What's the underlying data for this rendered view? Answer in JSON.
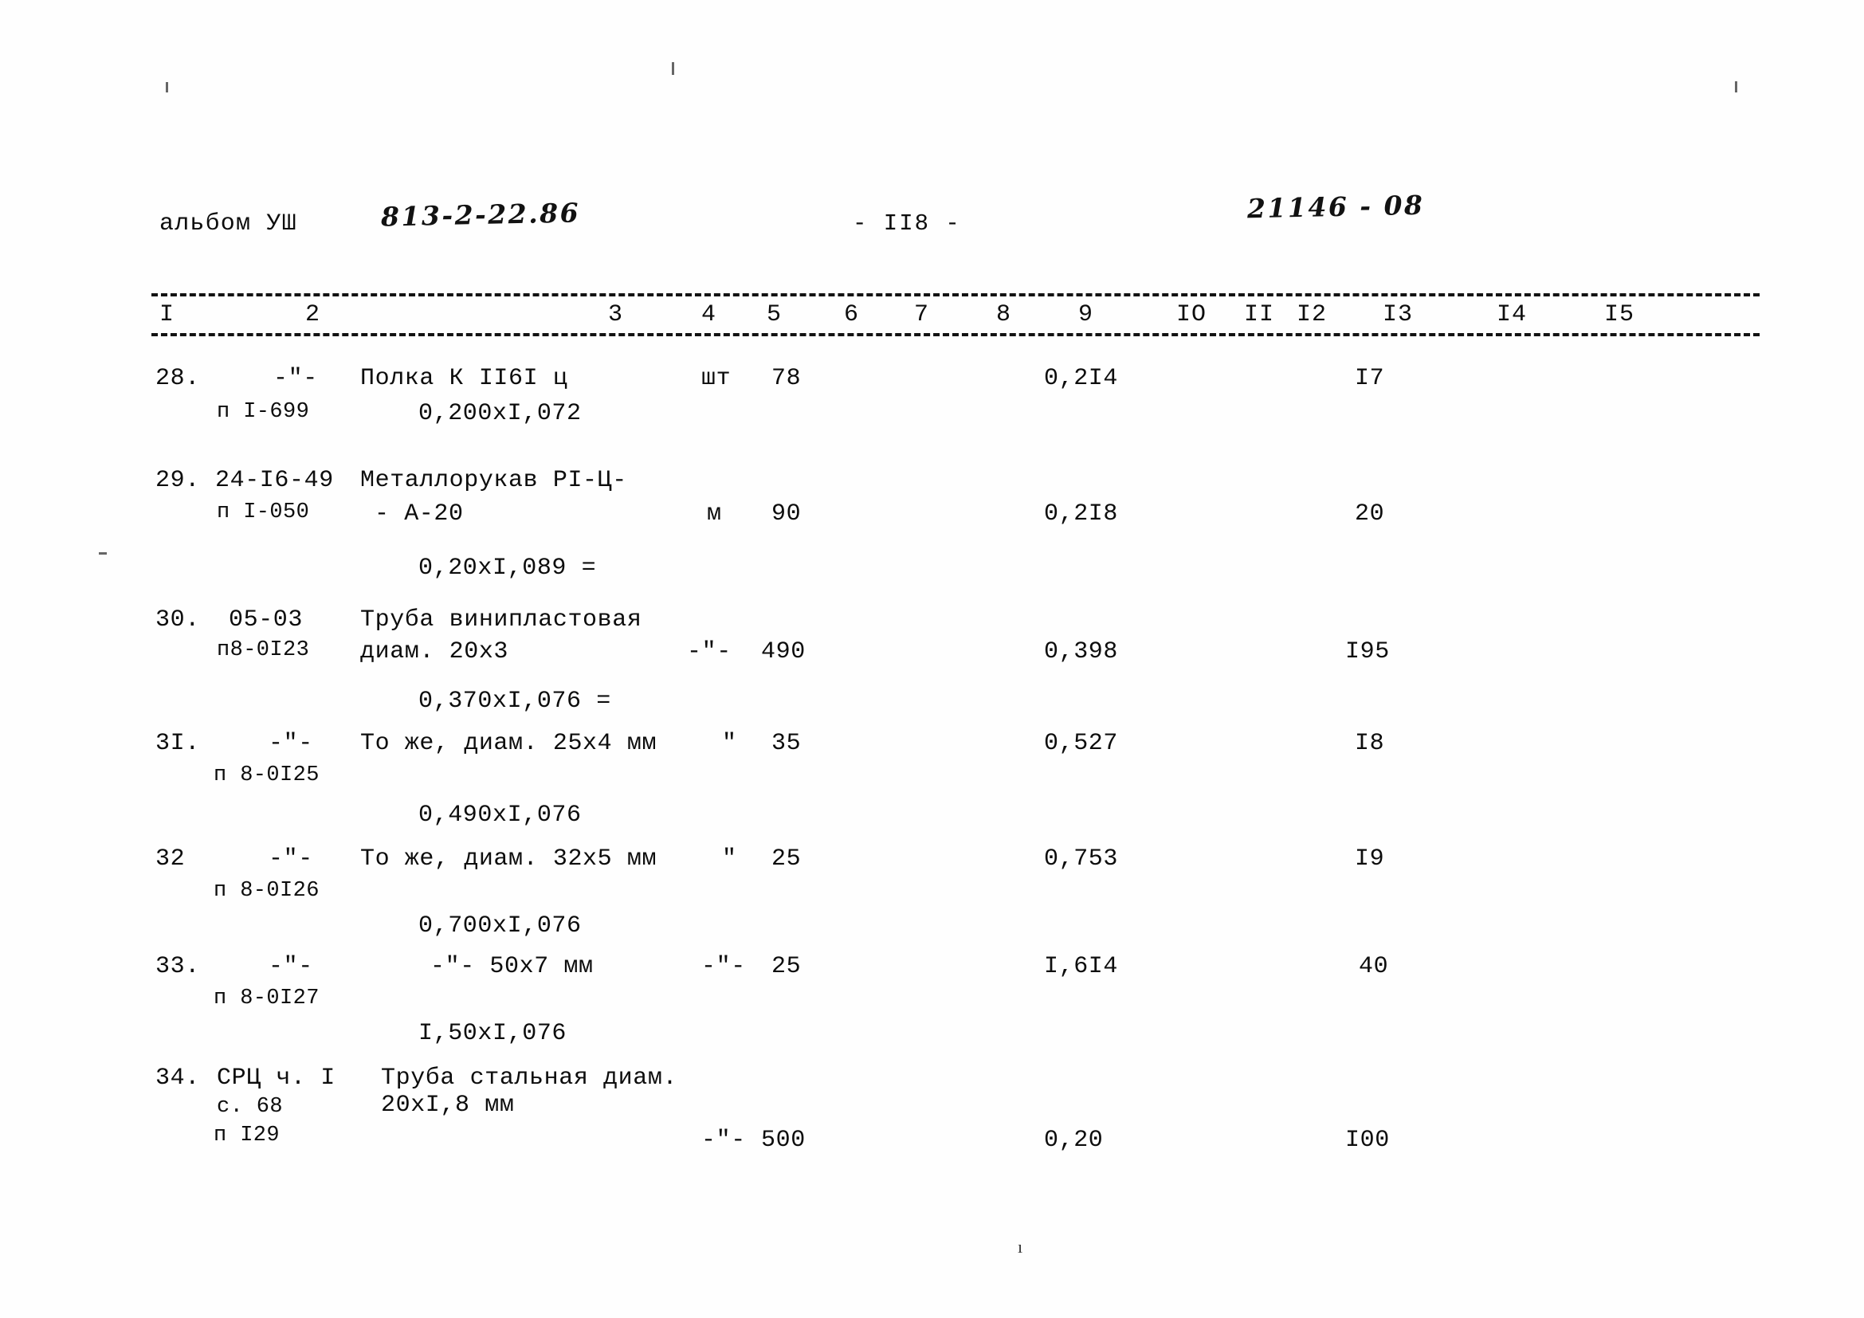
{
  "header": {
    "album_label": "альбом УШ",
    "album_code": "813-2-22.86",
    "page_number": "- II8 -",
    "doc_code": "21146 - 08"
  },
  "table": {
    "column_numbers": [
      "I",
      "2",
      "3",
      "4",
      "5",
      "6",
      "7",
      "8",
      "9",
      "IO",
      "II",
      "I2",
      "I3",
      "I4",
      "I5"
    ],
    "rows": [
      {
        "no": "28.",
        "code_line1": "-\"-",
        "code_line2": "п I-699",
        "name_line1": "Полка К II6I ц",
        "name_line2": "0,200xI,072",
        "unit": "шт",
        "qty": "78",
        "col9": "0,2I4",
        "col13": "I7"
      },
      {
        "no": "29.",
        "code_line1": "24-I6-49",
        "code_line2": "п I-050",
        "name_line1": "Металлорукав РI-Ц-",
        "name_line2": "- А-20",
        "name_line3": "0,20xI,089 =",
        "unit": "м",
        "qty": "90",
        "col9": "0,2I8",
        "col13": "20"
      },
      {
        "no": "30.",
        "code_line1": "05-03",
        "code_line2": "п8-0I23",
        "name_line1": "Труба винипластовая",
        "name_line2": "диам. 20x3",
        "name_line3": "0,370xI,076 =",
        "unit": "-\"-",
        "qty": "490",
        "col9": "0,398",
        "col13": "I95"
      },
      {
        "no": "3I.",
        "code_line1": "-\"-",
        "code_line2": "п 8-0I25",
        "name_line1": "То же, диам. 25x4 мм",
        "name_line2": "0,490xI,076",
        "unit": "\"",
        "qty": "35",
        "col9": "0,527",
        "col13": "I8"
      },
      {
        "no": "32",
        "code_line1": "-\"-",
        "code_line2": "п 8-0I26",
        "name_line1": "То же, диам. 32x5 мм",
        "name_line2": "0,700xI,076",
        "unit": "\"",
        "qty": "25",
        "col9": "0,753",
        "col13": "I9"
      },
      {
        "no": "33.",
        "code_line1": "-\"-",
        "code_line2": "п 8-0I27",
        "name_line1": "-\"- 50x7 мм",
        "name_line2": "I,50xI,076",
        "unit": "-\"-",
        "qty": "25",
        "col9": "I,6I4",
        "col13": "40"
      },
      {
        "no": "34.",
        "code_line1": "СРЦ ч. I",
        "code_line2": "с. 68",
        "code_line3": "п I29",
        "name_line1": "Труба стальная диам.",
        "name_line2": "20xI,8 мм",
        "unit": "-\"-",
        "qty": "500",
        "col9": "0,20",
        "col13": "I00"
      }
    ]
  },
  "footer": {
    "tick": "ı"
  }
}
